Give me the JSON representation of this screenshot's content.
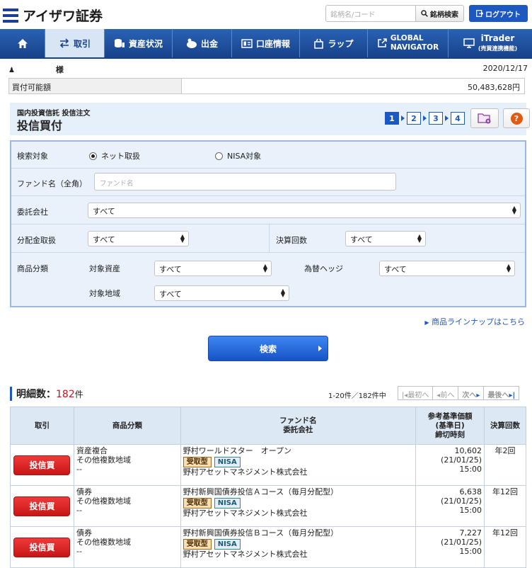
{
  "header": {
    "logo_text": "アイザワ証券",
    "search_placeholder": "銘柄名/コード",
    "search_button": "銘柄検索",
    "logout_button": "ログアウト"
  },
  "nav": {
    "home_icon": "home-icon",
    "items": [
      {
        "label": "取引",
        "icon": "trade-icon",
        "active": true
      },
      {
        "label": "資産状況",
        "icon": "assets-icon"
      },
      {
        "label": "出金",
        "icon": "withdraw-icon"
      },
      {
        "label": "口座情報",
        "icon": "account-icon"
      },
      {
        "label": "ラップ",
        "icon": "wrap-icon"
      },
      {
        "label": "GLOBAL NAVIGATOR",
        "line1": "GLOBAL",
        "line2": "NAVIGATOR",
        "icon": "external-link-icon"
      },
      {
        "label": "iTrader",
        "line1": "iTrader",
        "line2": "(売買連携機能)",
        "icon": "monitor-icon"
      }
    ]
  },
  "user": {
    "name_suffix": "様",
    "date": "2020/12/17",
    "balance_label": "買付可能額",
    "balance_value": "50,483,628円"
  },
  "title": {
    "sub": "国内投資信託 投信注文",
    "main": "投信買付",
    "steps": [
      "1",
      "2",
      "3",
      "4"
    ],
    "current_step": 1
  },
  "form": {
    "target_label": "検索対象",
    "target_options": [
      "ネット取扱",
      "NISA対象"
    ],
    "target_selected": "ネット取扱",
    "fund_label": "ファンド名（全角）",
    "fund_placeholder": "ファンド名",
    "company_label": "委託会社",
    "company_value": "すべて",
    "dividend_label": "分配金取扱",
    "dividend_value": "すべて",
    "settle_label": "決算回数",
    "settle_value": "すべて",
    "category_label": "商品分類",
    "asset_label": "対象資産",
    "asset_value": "すべて",
    "hedge_label": "為替ヘッジ",
    "hedge_value": "すべて",
    "region_label": "対象地域",
    "region_value": "すべて"
  },
  "lineup_link": "商品ラインナップはこちら",
  "search_button": "検索",
  "results": {
    "count_label": "明細数：",
    "count": "182",
    "count_unit": "件",
    "range": "1-20件／182件中",
    "pager": {
      "first": "最初へ",
      "prev": "前へ",
      "next": "次へ",
      "last": "最後へ"
    },
    "columns": {
      "trade": "取引",
      "category": "商品分類",
      "fund_line1": "ファンド名",
      "fund_line2": "委託会社",
      "price_line1": "参考基準価額",
      "price_line2": "(基準日)",
      "price_line3": "締切時刻",
      "freq": "決算回数"
    },
    "buy_label": "投信買",
    "rows": [
      {
        "cat1": "資産複合",
        "cat2": "その他複数地域",
        "cat3": "--",
        "fund": "野村ワールドスター　オープン",
        "tag1": "受取型",
        "tag2": "NISA",
        "company": "野村アセットマネジメント株式会社",
        "price": "10,602",
        "date": "(21/01/25)",
        "time": "15:00",
        "freq": "年2回"
      },
      {
        "cat1": "債券",
        "cat2": "その他複数地域",
        "cat3": "--",
        "fund": "野村新興国債券投信Ａコース（毎月分配型）",
        "tag1": "受取型",
        "tag2": "NISA",
        "company": "野村アセットマネジメント株式会社",
        "price": "6,638",
        "date": "(21/01/25)",
        "time": "15:00",
        "freq": "年12回"
      },
      {
        "cat1": "債券",
        "cat2": "その他複数地域",
        "cat3": "--",
        "fund": "野村新興国債券投信Ｂコース（毎月分配型）",
        "tag1": "受取型",
        "tag2": "NISA",
        "company": "野村アセットマネジメント株式会社",
        "price": "7,227",
        "date": "(21/01/25)",
        "time": "15:00",
        "freq": "年12回"
      }
    ]
  }
}
